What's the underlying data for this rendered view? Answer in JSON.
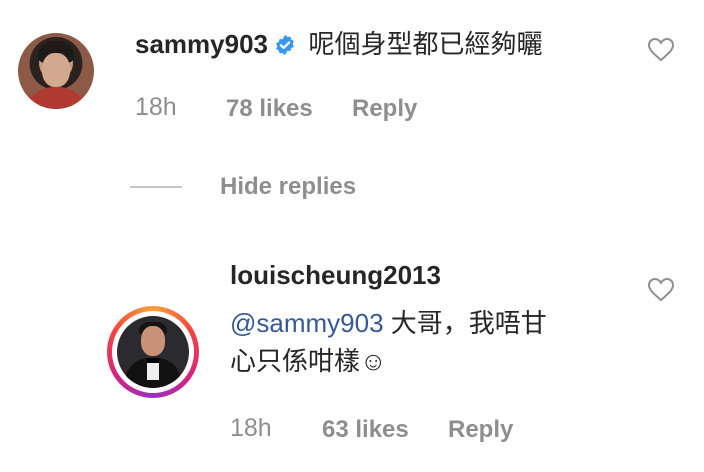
{
  "comments": [
    {
      "username": "sammy903",
      "verified": true,
      "text": "呢個身型都已經夠曬",
      "time": "18h",
      "likes": "78 likes",
      "reply_label": "Reply"
    }
  ],
  "replies_toggle": {
    "label": "Hide replies"
  },
  "replies": [
    {
      "username": "louischeung2013",
      "mention": "@sammy903",
      "text_line1": " 大哥，我唔甘",
      "text_line2": "心只係咁樣☺",
      "time": "18h",
      "likes": "63 likes",
      "reply_label": "Reply"
    }
  ],
  "icons": {
    "verified": "verified-badge-icon",
    "heart": "heart-outline-icon"
  },
  "colors": {
    "verified_blue": "#3897f0",
    "mention_blue": "#385898",
    "meta_gray": "#8e8e8e"
  }
}
